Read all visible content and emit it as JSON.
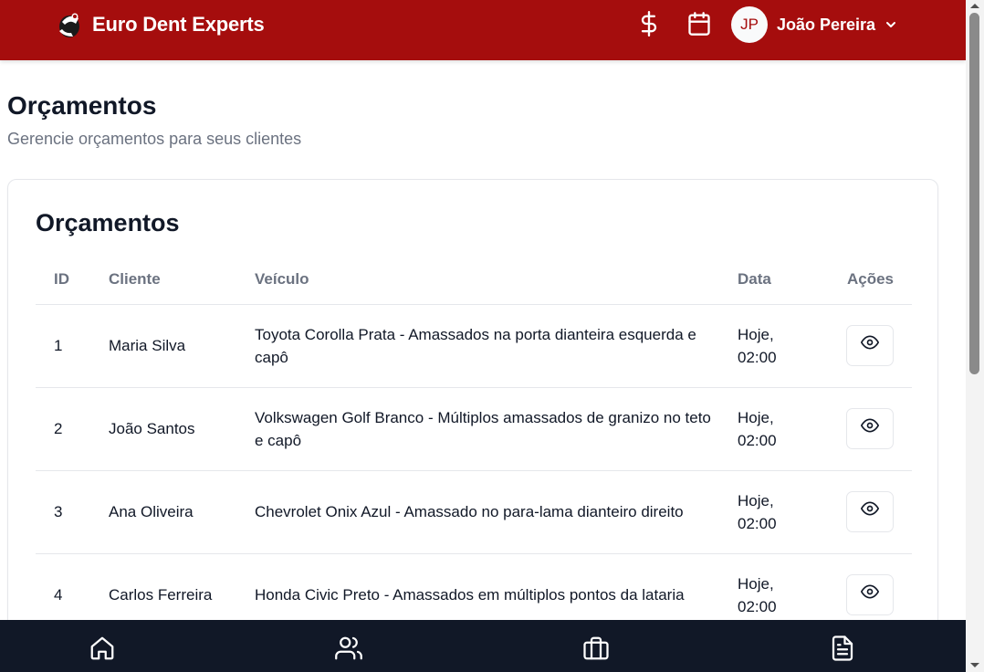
{
  "header": {
    "brand": "Euro Dent Experts",
    "icons": [
      "dollar-icon",
      "calendar-icon"
    ],
    "user": {
      "initials": "JP",
      "name": "João Pereira"
    },
    "colors": {
      "primary": "#a50d0d",
      "nav": "#111827"
    }
  },
  "page": {
    "title": "Orçamentos",
    "subtitle": "Gerencie orçamentos para seus clientes"
  },
  "card": {
    "title": "Orçamentos",
    "columns": [
      "ID",
      "Cliente",
      "Veículo",
      "Data",
      "Ações"
    ],
    "rows": [
      {
        "id": "1",
        "client": "Maria Silva",
        "vehicle": "Toyota Corolla Prata - Amassados na porta dianteira esquerda e capô",
        "date_day": "Hoje,",
        "date_time": "02:00"
      },
      {
        "id": "2",
        "client": "João Santos",
        "vehicle": "Volkswagen Golf Branco - Múltiplos amassados de granizo no teto e capô",
        "date_day": "Hoje,",
        "date_time": "02:00"
      },
      {
        "id": "3",
        "client": "Ana Oliveira",
        "vehicle": "Chevrolet Onix Azul - Amassado no para-lama dianteiro direito",
        "date_day": "Hoje,",
        "date_time": "02:00"
      },
      {
        "id": "4",
        "client": "Carlos Ferreira",
        "vehicle": "Honda Civic Preto - Amassados em múltiplos pontos da lataria",
        "date_day": "Hoje,",
        "date_time": "02:00"
      }
    ]
  },
  "bottom_nav": {
    "items": [
      "home-icon",
      "users-icon",
      "briefcase-icon",
      "document-icon"
    ]
  }
}
